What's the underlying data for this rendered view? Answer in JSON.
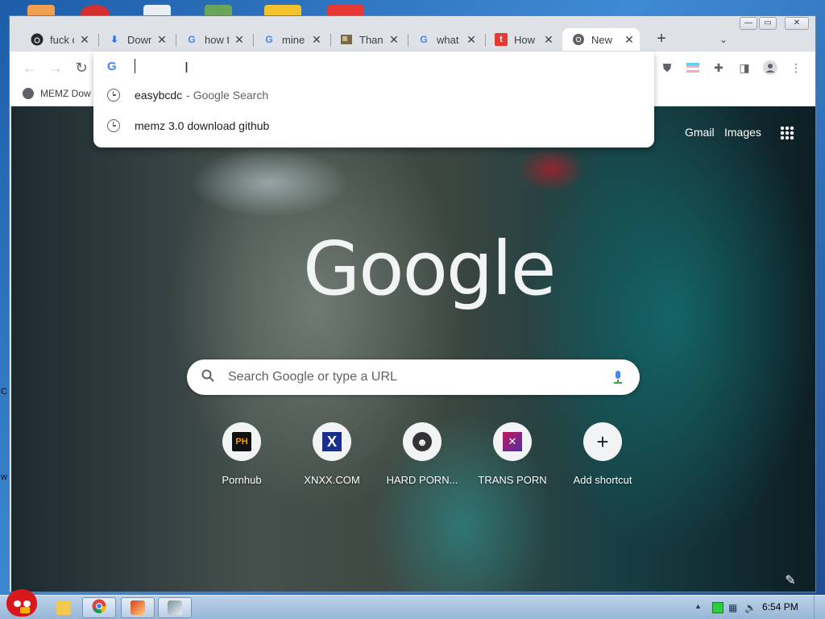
{
  "browser": {
    "tabs": [
      {
        "title": "fuck c",
        "favicon": "github-icon",
        "color": "#24292f"
      },
      {
        "title": "Down",
        "favicon": "download-icon",
        "color": "#1a73e8"
      },
      {
        "title": "how t",
        "favicon": "google-icon",
        "color": "#4285f4"
      },
      {
        "title": "mine",
        "favicon": "google-icon",
        "color": "#4285f4"
      },
      {
        "title": "Than",
        "favicon": "image-icon",
        "color": "#7a6a4a"
      },
      {
        "title": "what",
        "favicon": "google-icon",
        "color": "#4285f4"
      },
      {
        "title": "How",
        "favicon": "tumblr-icon",
        "color": "#e53935"
      },
      {
        "title": "New",
        "favicon": "chrome-icon",
        "color": "#5f6368",
        "active": true
      }
    ],
    "new_tab_symbol": "+",
    "tab_search_symbol": "⌄",
    "bookmarks": [
      {
        "label": "MEMZ Dow"
      }
    ]
  },
  "omnibox": {
    "logo_letter": "G",
    "value": "",
    "suggestions": [
      {
        "text": "easybcdc",
        "suffix": "- Google Search"
      },
      {
        "text": "memz 3.0 download github",
        "suffix": ""
      }
    ]
  },
  "ntp": {
    "gmail_label": "Gmail",
    "images_label": "Images",
    "logo_text": "Google",
    "search_placeholder": "Search Google or type a URL",
    "shortcuts": [
      {
        "label": "Pornhub",
        "badge": "PH"
      },
      {
        "label": "XNXX.COM",
        "badge": "X"
      },
      {
        "label": "HARD PORN...",
        "badge": "☻"
      },
      {
        "label": "TRANS PORN",
        "badge": "✕"
      },
      {
        "label": "Add shortcut",
        "badge": "+"
      }
    ]
  },
  "taskbar": {
    "clock": "6:54 PM",
    "tray_expand": "▲"
  },
  "desktop": {
    "edge_letters": [
      "C",
      "w"
    ]
  },
  "colors": {
    "google_blue": "#4285f4",
    "window_frame": "#dee1e6"
  }
}
